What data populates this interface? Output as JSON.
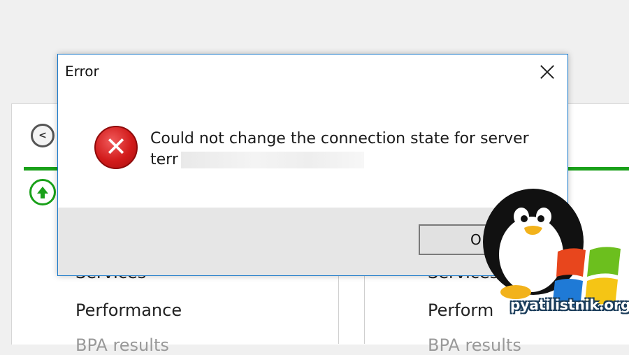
{
  "dialog": {
    "title": "Error",
    "message_line1": "Could not change the connection state for server",
    "message_line2_prefix": "terr",
    "ok_label": "O"
  },
  "background": {
    "connect_icon": "connection-icon",
    "left_items": [
      "Services",
      "Performance",
      "BPA results"
    ],
    "right_items": [
      "Services",
      "Perform",
      "BPA results"
    ]
  },
  "watermark": {
    "text": "pyatilistnik.org"
  },
  "colors": {
    "accent": "#1979ca",
    "error_red": "#d21b1b",
    "status_green": "#19a019"
  }
}
